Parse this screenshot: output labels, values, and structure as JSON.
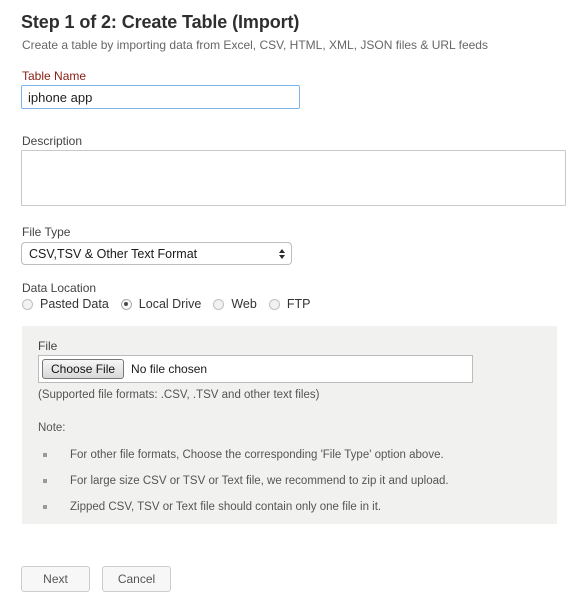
{
  "header": {
    "title": "Step 1 of 2: Create Table (Import)",
    "subtitle": "Create a table by importing data from Excel, CSV, HTML, XML, JSON files & URL feeds"
  },
  "form": {
    "table_name": {
      "label": "Table Name",
      "value": "iphone app",
      "placeholder": ""
    },
    "description": {
      "label": "Description",
      "value": "",
      "placeholder": ""
    },
    "file_type": {
      "label": "File Type",
      "selected": "CSV,TSV & Other Text Format"
    },
    "data_location": {
      "label": "Data Location",
      "options": [
        {
          "label": "Pasted Data",
          "selected": false
        },
        {
          "label": "Local Drive",
          "selected": true
        },
        {
          "label": "Web",
          "selected": false
        },
        {
          "label": "FTP",
          "selected": false
        }
      ]
    }
  },
  "upload_panel": {
    "file_label": "File",
    "choose_file_button": "Choose File",
    "file_chosen_text": "No file chosen",
    "supported_formats": "(Supported file formats: .CSV, .TSV and other text files)",
    "note_title": "Note:",
    "notes": [
      "For other file formats, Choose the corresponding 'File Type' option above.",
      "For large size CSV or TSV or Text file, we recommend to zip it and upload.",
      "Zipped CSV, TSV or Text file should contain only one file in it."
    ]
  },
  "footer": {
    "next_label": "Next",
    "cancel_label": "Cancel"
  },
  "colors": {
    "required_label": "#8c1c13",
    "focus_border": "#7eb4e8",
    "panel_background": "#f1f1f0",
    "title": "#2f2f2f"
  }
}
